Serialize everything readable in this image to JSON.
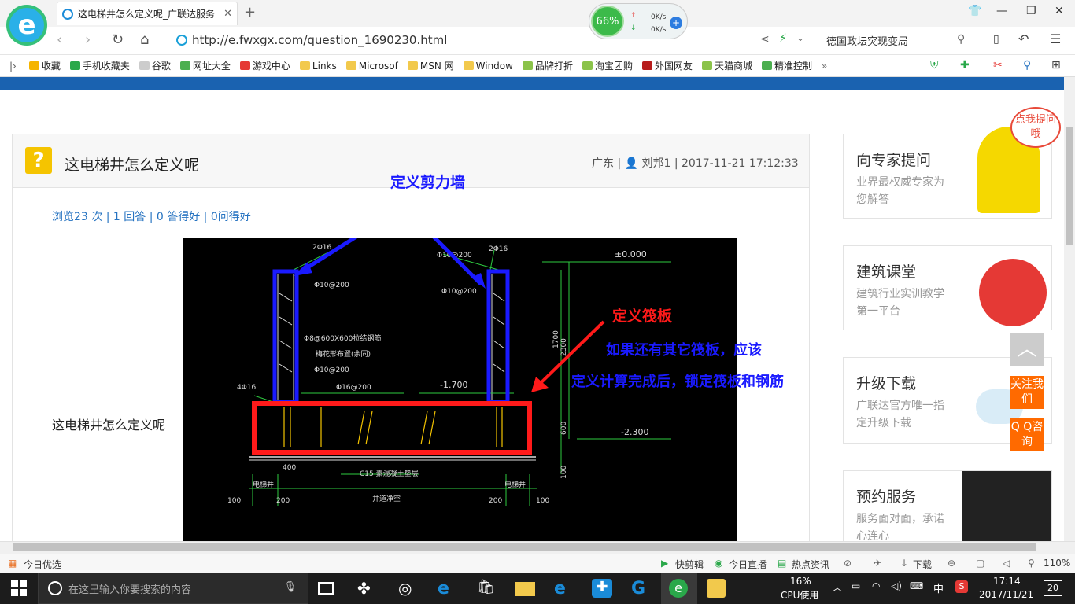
{
  "browser": {
    "tab_title": "这电梯井怎么定义呢_广联达服务",
    "tab_close": "✕",
    "new_tab": "+",
    "url": "http://e.fwxgx.com/question_1690230.html",
    "search_hint": "德国政坛突现变局",
    "speed": {
      "percent": "66%",
      "up": "0K/s",
      "down": "0K/s"
    }
  },
  "bookmarks": [
    {
      "label": "收藏",
      "color": "#f5b400"
    },
    {
      "label": "手机收藏夹",
      "color": "#2aa84a"
    },
    {
      "label": "谷歌",
      "color": "#888888"
    },
    {
      "label": "网址大全",
      "color": "#4caf50"
    },
    {
      "label": "游戏中心",
      "color": "#e53935"
    },
    {
      "label": "Links",
      "color": "#f2c94c"
    },
    {
      "label": "Microsof",
      "color": "#f2c94c"
    },
    {
      "label": "MSN 网",
      "color": "#f2c94c"
    },
    {
      "label": "Window",
      "color": "#f2c94c"
    },
    {
      "label": "品牌打折",
      "color": "#8bc34a"
    },
    {
      "label": "淘宝团购",
      "color": "#8bc34a"
    },
    {
      "label": "外国网友",
      "color": "#b71c1c"
    },
    {
      "label": "天猫商城",
      "color": "#8bc34a"
    },
    {
      "label": "精准控制",
      "color": "#4caf50"
    }
  ],
  "question": {
    "title": "这电梯井怎么定义呢",
    "meta": "广东 | 👤 刘邦1 | 2017-11-21 17:12:33",
    "stats": "浏览23 次 | 1 回答 | 0 答得好 | 0问得好",
    "body_text": "这电梯井怎么定义呢"
  },
  "annotations": {
    "shear_wall": "定义剪力墙",
    "raft": "定义筏板",
    "note1": "如果还有其它筏板，应该",
    "note2": "定义计算完成后，锁定筏板和钢筋"
  },
  "cad_labels": {
    "top_left_rebar": "2Φ16",
    "top_right_rebar": "2Φ16",
    "stirrup_top": "Φ10@200",
    "stirrup_left": "Φ10@200",
    "stirrup_right": "Φ10@200",
    "ties": "Φ8@600X600拉结钢筋",
    "ties_note": "梅花形布置(余同)",
    "stirrup_mid": "Φ10@200",
    "bottom_rebar": "Φ16@200",
    "edge_rebar": "4Φ16",
    "elev_top": "±0.000",
    "elev_mid": "-1.700",
    "elev_bot": "-2.300",
    "dim_2300": "2300",
    "dim_1700": "1700",
    "dim_600": "600",
    "dim_100": "100",
    "dim_400": "400",
    "c15": "C15 素混凝土垫层",
    "wall_left": "电梯井",
    "wall_right": "电梯井",
    "clear": "井道净空",
    "d100a": "100",
    "d200a": "200",
    "d200b": "200",
    "d100b": "100"
  },
  "sidebar": {
    "ask_bubble": "点我提问哦",
    "cards": [
      {
        "title": "向专家提问",
        "sub": "业界最权威专家为您解答"
      },
      {
        "title": "建筑课堂",
        "sub": "建筑行业实训教学第一平台"
      },
      {
        "title": "升级下载",
        "sub": "广联达官方唯一指定升级下载"
      },
      {
        "title": "预约服务",
        "sub": "服务面对面，承诺心连心"
      }
    ],
    "back_top": "︿",
    "follow": "关注我们",
    "qq": "Q Q咨询"
  },
  "statusbar": {
    "left": "今日优选",
    "items": [
      "快剪辑",
      "今日直播",
      "热点资讯",
      "下载"
    ],
    "zoom": "110%"
  },
  "taskbar": {
    "search_placeholder": "在这里输入你要搜索的内容",
    "cpu_pct": "16%",
    "cpu_label": "CPU使用",
    "ime": "中",
    "time": "17:14",
    "date": "2017/11/21",
    "notifications": "20"
  }
}
